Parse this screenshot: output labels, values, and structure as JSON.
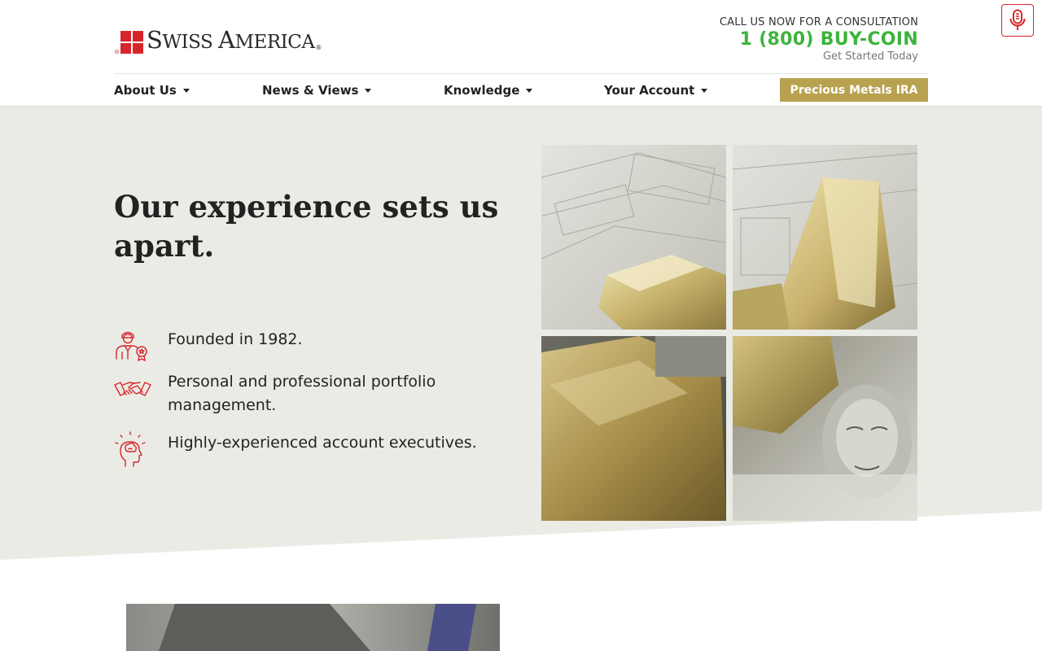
{
  "brand": {
    "name_big_1": "S",
    "name_small_1": "WISS ",
    "name_big_2": "A",
    "name_small_2": "MERICA",
    "colors": {
      "brand_red": "#d7262b",
      "phone_green": "#3cb43a",
      "gold": "#b8a24f",
      "hero_bg": "#ebebe6"
    }
  },
  "header": {
    "cta_label": "CALL US NOW FOR A CONSULTATION",
    "phone": "1 (800) BUY-COIN",
    "cta_sub": "Get Started Today",
    "mic_icon": "microphone-icon"
  },
  "nav": {
    "items": [
      {
        "label": "About Us"
      },
      {
        "label": "News & Views"
      },
      {
        "label": "Knowledge"
      },
      {
        "label": "Your Account"
      }
    ],
    "ira_label": "Precious Metals IRA"
  },
  "hero": {
    "headline": "Our experience sets us apart.",
    "features": [
      {
        "icon": "certified-person-icon",
        "text": "Founded in 1982."
      },
      {
        "icon": "handshake-icon",
        "text": "Personal and professional portfolio management."
      },
      {
        "icon": "head-idea-icon",
        "text": "Highly-experienced account executives."
      }
    ],
    "image_tiles": [
      "gold-bars-on-dollars-image",
      "gold-bar-image",
      "gold-bars-image",
      "benjamin-franklin-bill-image"
    ]
  }
}
